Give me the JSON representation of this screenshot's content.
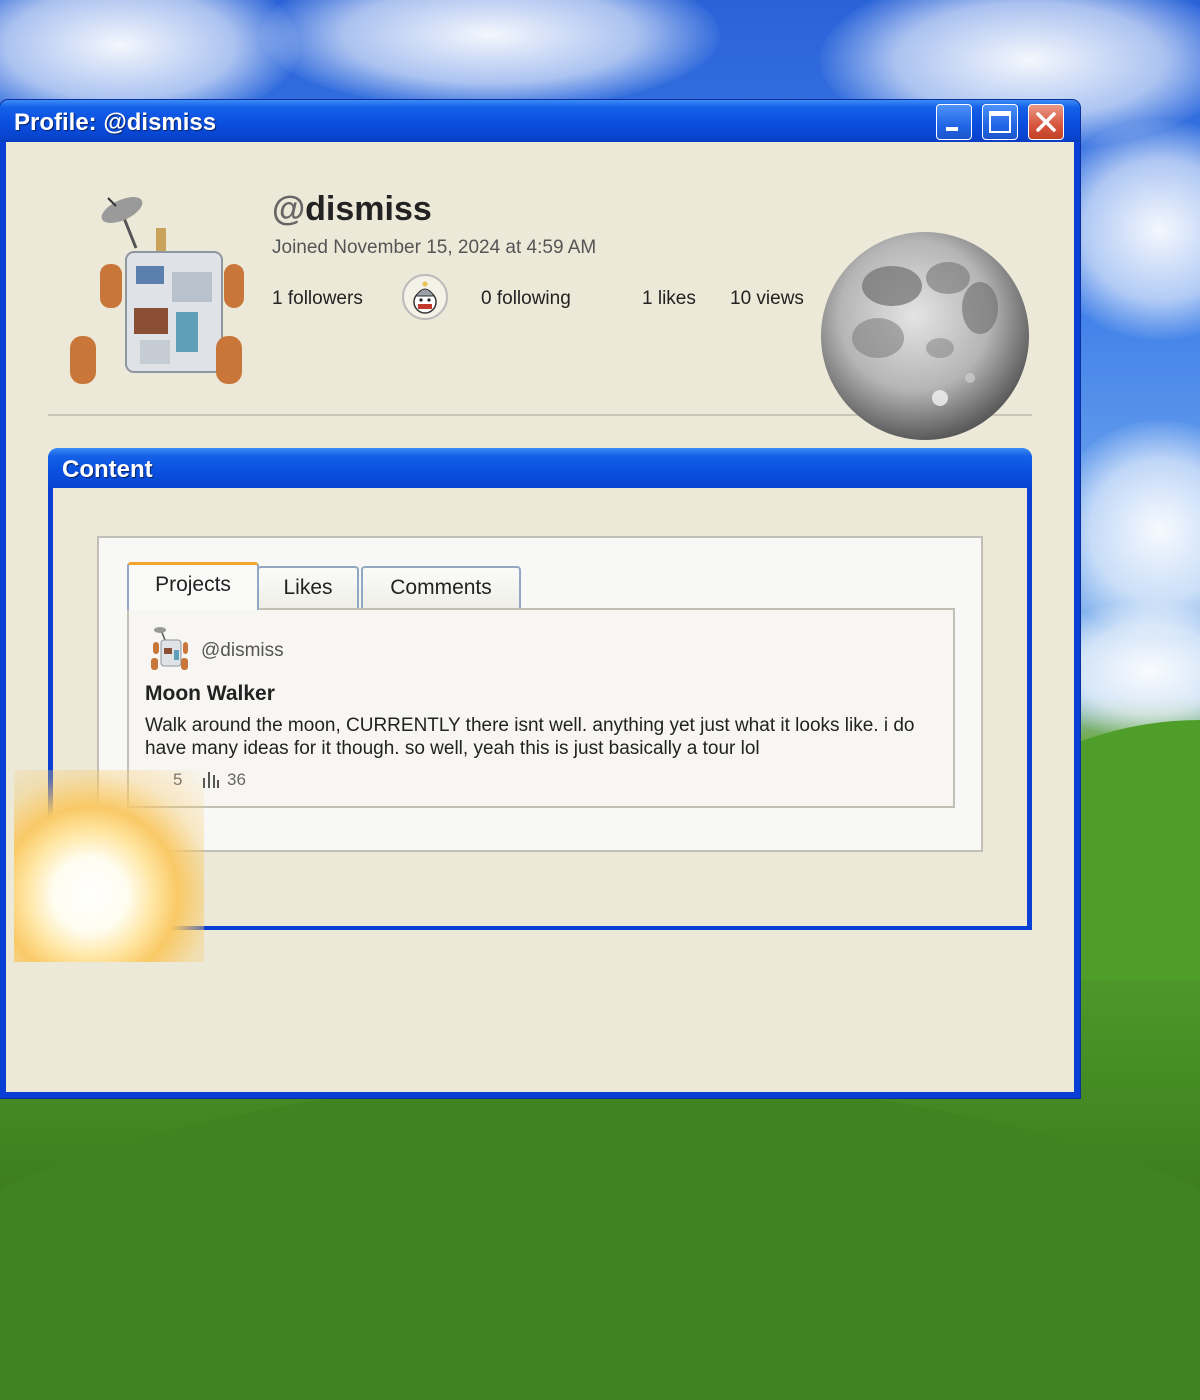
{
  "window": {
    "title": "Profile: @dismiss",
    "controls": [
      "minimize-icon",
      "maximize-icon",
      "close-icon"
    ]
  },
  "profile": {
    "at": "@",
    "name": "dismiss",
    "joined": "Joined November 15, 2024 at 4:59 AM",
    "followers": "1 followers",
    "following": "0 following",
    "likes": "1 likes",
    "views": "10 views"
  },
  "content": {
    "title": "Content",
    "tabs": [
      "Projects",
      "Likes",
      "Comments"
    ],
    "active_tab": "Projects",
    "post": {
      "author": "@dismiss",
      "title": "Moon Walker",
      "description": "Walk around the moon, CURRENTLY there isnt well. anything yet just what it looks like. i do have many ideas for it though. so well, yeah this is just basically a tour lol",
      "likes": "5",
      "views": "36"
    }
  },
  "colors": {
    "title_bar": "#0a4fe0",
    "window_bg": "#ece9d8",
    "active_tab_accent": "#f0a62a"
  }
}
